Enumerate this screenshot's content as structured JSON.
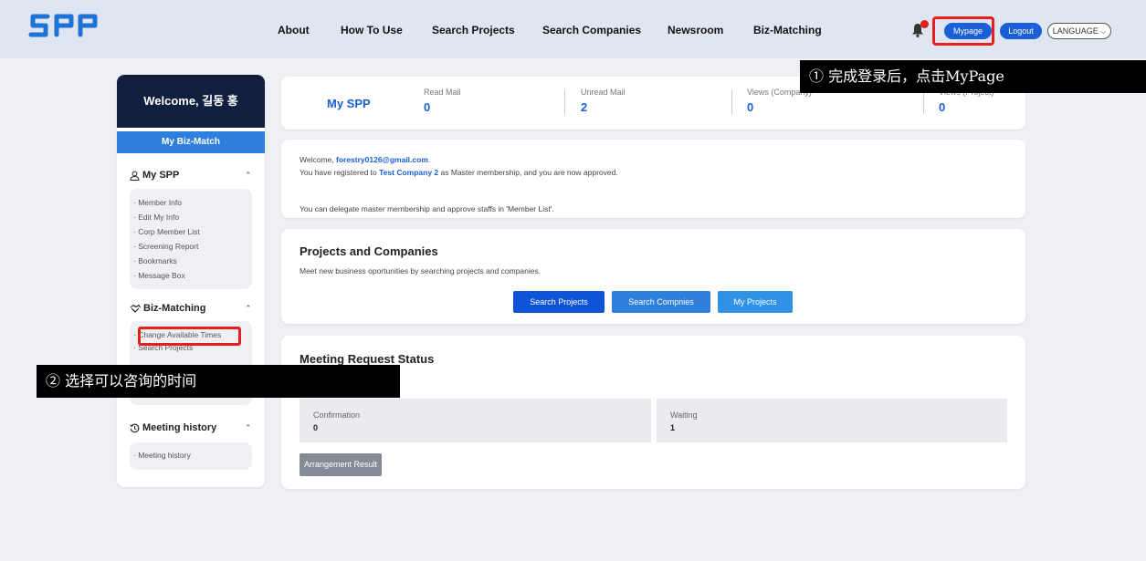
{
  "header": {
    "logo": "SPP",
    "nav": [
      "About",
      "How To Use",
      "Search Projects",
      "Search Companies",
      "Newsroom",
      "Biz-Matching"
    ],
    "mypage": "Mypage",
    "logout": "Logout",
    "language": "LANGUAGE"
  },
  "callouts": {
    "step1": "① 完成登录后，点击MyPage",
    "step2": "② 选择可以咨询的时间"
  },
  "sidebar": {
    "welcome": "Welcome, 길동 홍",
    "my_biz_match": "My Biz-Match",
    "my_spp": {
      "title": "My SPP",
      "items": [
        "Member Info",
        "Edit My Info",
        "Corp Member List",
        "Screening Report",
        "Bookmarks",
        "Message Box"
      ]
    },
    "biz_matching": {
      "title": "Biz-Matching",
      "items": [
        "Change Available Times",
        "Search Projects"
      ]
    },
    "meeting_history": {
      "title": "Meeting history",
      "items": [
        "Meeting history"
      ]
    }
  },
  "stats": {
    "title": "My SPP",
    "read_mail_label": "Read Mail",
    "read_mail": "0",
    "unread_mail_label": "Unread Mail",
    "unread_mail": "2",
    "views_company_label": "Views (Company)",
    "views_company": "0",
    "views_project_label": "Views (Project)",
    "views_project": "0"
  },
  "welcome_card": {
    "line1_prefix": "Welcome, ",
    "email": "forestry0126@gmail.com",
    "line1_suffix": ".",
    "line2_prefix": "You have registered to ",
    "company": "Test Company 2",
    "line2_suffix": " as Master membership, and you are now approved.",
    "line3": "You can delegate master membership and approve staffs in 'Member List'."
  },
  "projects": {
    "title": "Projects and Companies",
    "desc": "Meet new business oportunities by searching projects and companies.",
    "btn_search_projects": "Search Projects",
    "btn_search_companies": "Search Compnies",
    "btn_my_projects": "My Projects"
  },
  "meeting": {
    "title": "Meeting Request Status",
    "confirmation_label": "Confirmation",
    "confirmation": "0",
    "waiting_label": "Waiting",
    "waiting": "1",
    "result_btn": "Arrangement Result"
  },
  "colors": {
    "primary": "#1a5fd6",
    "dark_navy": "#0f1f3d",
    "highlight_red": "#e61e1e"
  }
}
